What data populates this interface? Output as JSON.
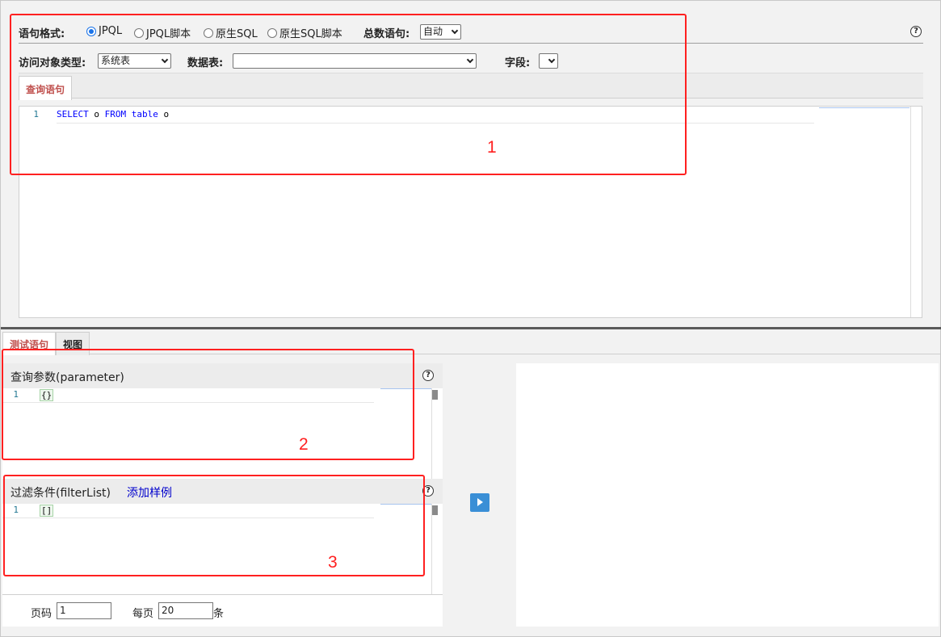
{
  "query_format": {
    "label": "语句格式:",
    "options": [
      {
        "label": "JPQL",
        "selected": true
      },
      {
        "label": "JPQL脚本",
        "selected": false
      },
      {
        "label": "原生SQL",
        "selected": false
      },
      {
        "label": "原生SQL脚本",
        "selected": false
      }
    ],
    "count_label": "总数语句:",
    "count_value": "自动"
  },
  "access": {
    "type_label": "访问对象类型:",
    "type_value": "系统表",
    "table_label": "数据表:",
    "table_value": "",
    "field_label": "字段:",
    "field_value": ""
  },
  "query_tab": "查询语句",
  "query_editor": {
    "line_number": "1",
    "kw_select": "SELECT",
    "t1": " o ",
    "kw_from": "FROM",
    "kw_table": " table",
    "t2": " o"
  },
  "bottom_tabs": [
    {
      "label": "测试语句",
      "active": true
    },
    {
      "label": "视图",
      "active": false
    }
  ],
  "parameter_panel": {
    "title": "查询参数(parameter)",
    "line_number": "1",
    "value": "{}"
  },
  "filter_panel": {
    "title": "过滤条件(filterList)",
    "link": "添加样例",
    "line_number": "1",
    "value": "[]"
  },
  "pager": {
    "page_label": "页码",
    "page_value": "1",
    "size_label": "每页",
    "size_value": "20",
    "unit": "条"
  },
  "help_glyph": "?",
  "annotations": [
    "1",
    "2",
    "3"
  ],
  "colors": {
    "annotation": "#ff2020",
    "active_tab": "#c0504d",
    "keyword": "#0000ff",
    "play_button": "#3a8fd6",
    "link": "#0000cc"
  },
  "icons": [
    "help-icon",
    "play-icon",
    "chevron-down-icon"
  ]
}
